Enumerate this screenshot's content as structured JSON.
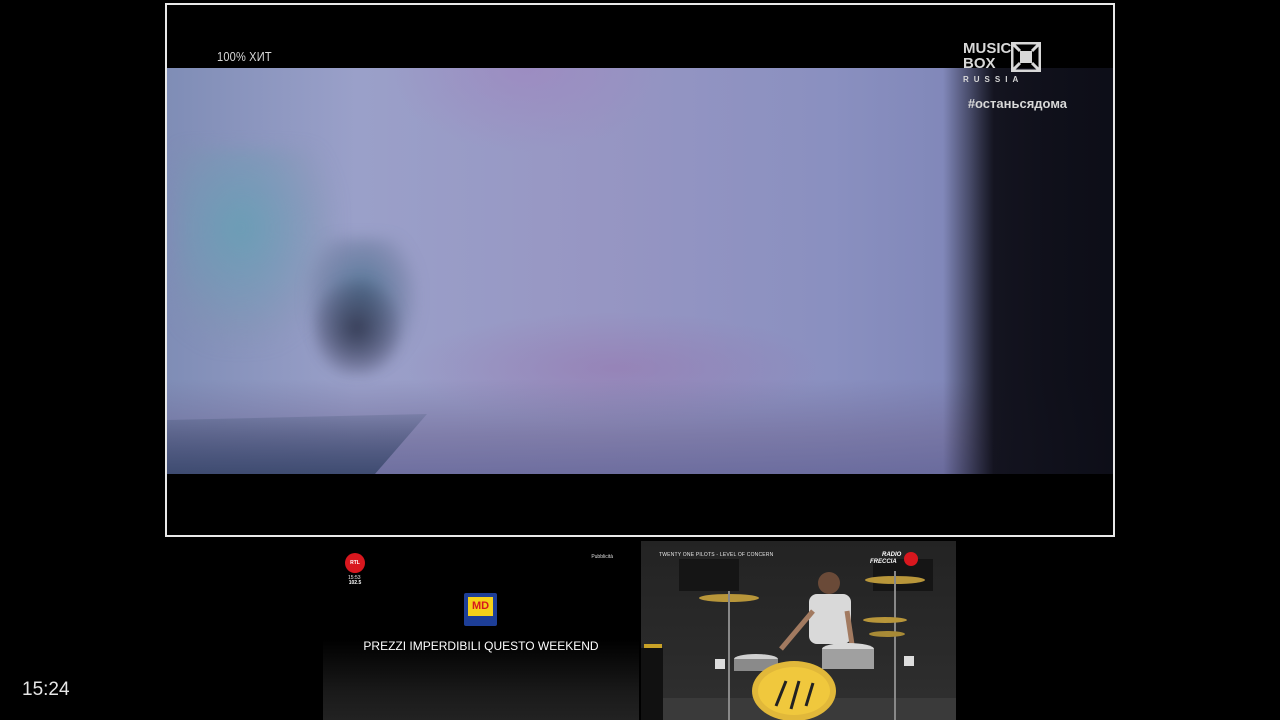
{
  "clock": "15:24",
  "main_channel": {
    "overlay_left": "100% ХИТ",
    "logo": {
      "line1": "MUSIC",
      "line2": "BOX",
      "line3": "RUSSIA"
    },
    "hashtag": "#останьсядома"
  },
  "tile_rtl": {
    "logo_text": "RTL 102.5",
    "time": "15:53",
    "corner_label": "Pubblicità",
    "brand_logo": "MD",
    "ad_text": "PREZZI IMPERDIBILI QUESTO WEEKEND"
  },
  "tile_drums": {
    "title": "TWENTY ONE PILOTS - LEVEL OF CONCERN",
    "station_line1": "RADIO",
    "station_line2": "FRECCIA"
  }
}
